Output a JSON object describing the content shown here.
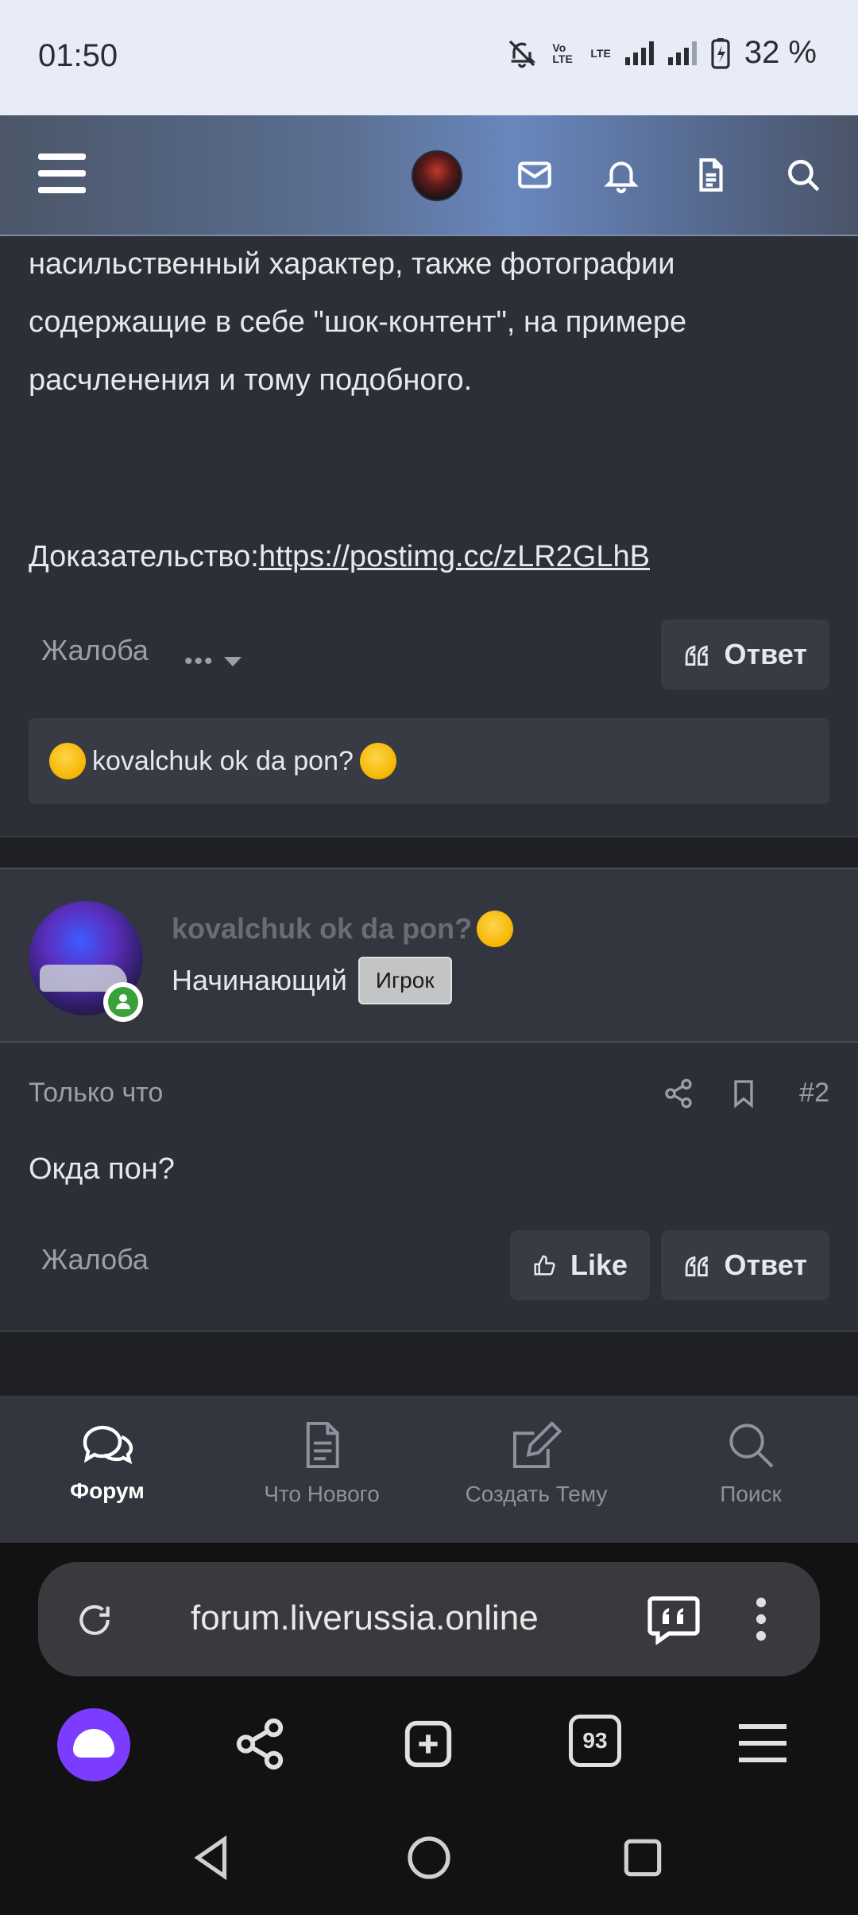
{
  "status_bar": {
    "time": "01:50",
    "battery": "32 %",
    "volte": "Vo LTE",
    "lte": "LTE"
  },
  "post1": {
    "lines": [
      "насильственный характер, также фотографии",
      "содержащие в себе \"шок-контент\", на примере",
      "расчленения и тому подобного."
    ],
    "proof_label": "Доказательство:",
    "proof_link": "https://postimg.cc/zLR2GLhB",
    "complaint": "Жалоба",
    "more": "•••",
    "reply": "Ответ",
    "reaction_text": "kovalchuk ok da pon?"
  },
  "user": {
    "name": "kovalchuk ok da pon?",
    "rank": "Начинающий",
    "badge": "Игрок"
  },
  "post2": {
    "time": "Только что",
    "number": "#2",
    "text": "Окда пон?",
    "complaint": "Жалоба",
    "like": "Like",
    "reply": "Ответ"
  },
  "bottom_nav": [
    {
      "label": "Форум",
      "icon": "chat-bubbles-icon",
      "active": true
    },
    {
      "label": "Что Нового",
      "icon": "document-icon",
      "active": false
    },
    {
      "label": "Создать Тему",
      "icon": "edit-icon",
      "active": false
    },
    {
      "label": "Поиск",
      "icon": "search-icon",
      "active": false
    }
  ],
  "browser": {
    "url": "forum.liverussia.online",
    "tabs_count": "93"
  }
}
